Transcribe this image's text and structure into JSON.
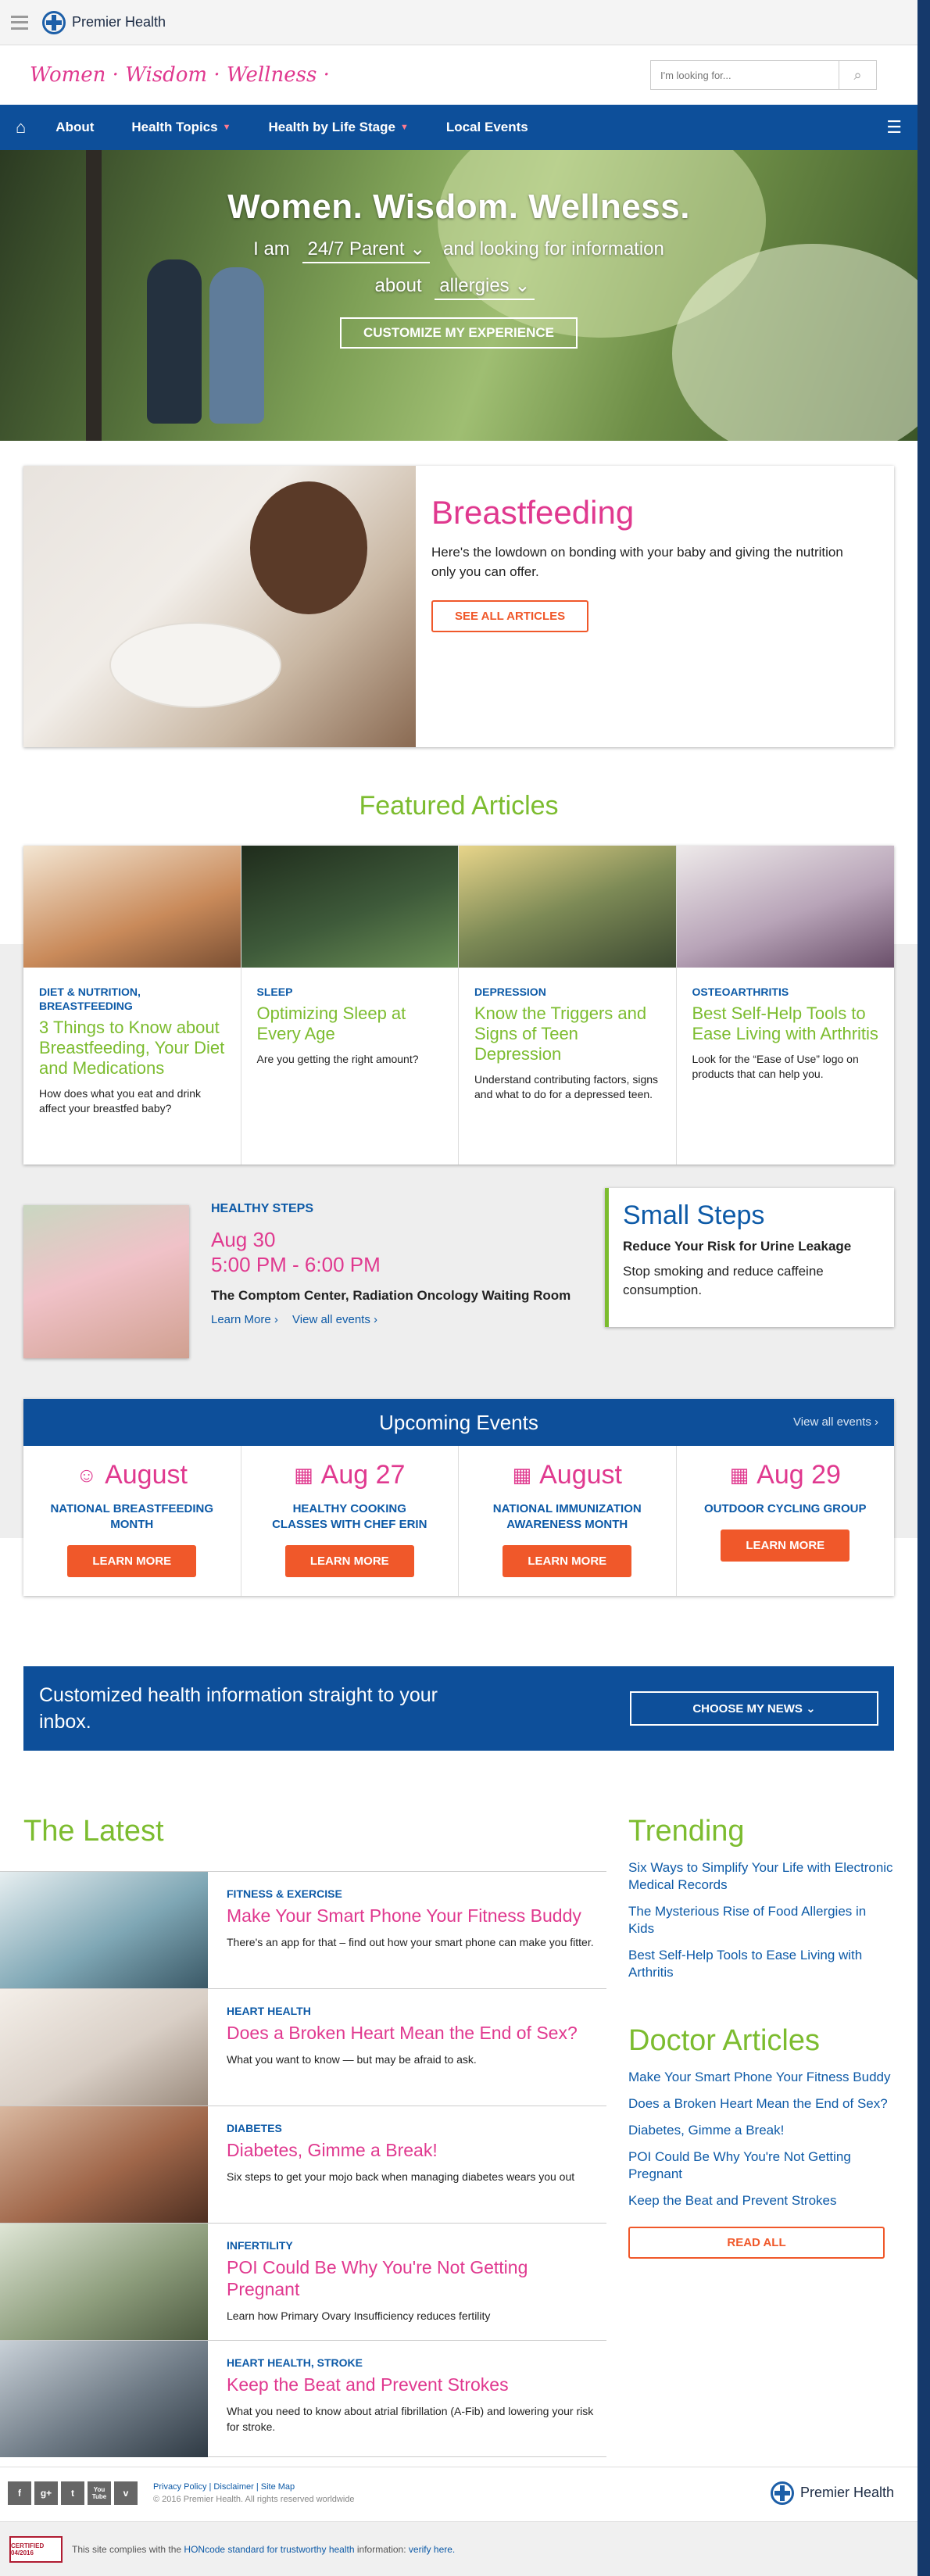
{
  "header": {
    "brand": "Premier Health",
    "tagline": "Women · Wisdom · Wellness ·",
    "search_placeholder": "I'm looking for..."
  },
  "nav": {
    "items": [
      {
        "label": "About"
      },
      {
        "label": "Health Topics"
      },
      {
        "label": "Health by Life Stage"
      },
      {
        "label": "Local Events"
      }
    ]
  },
  "hero": {
    "title": "Women. Wisdom. Wellness.",
    "iam": "I am",
    "persona": "24/7 Parent",
    "looking": "and looking for information",
    "about": "about",
    "topic": "allergies",
    "button": "CUSTOMIZE MY EXPERIENCE"
  },
  "feature": {
    "title": "Breastfeeding",
    "text": "Here's the lowdown on bonding with your baby and giving the nutrition only you can offer.",
    "button": "SEE ALL ARTICLES"
  },
  "featured": {
    "heading": "Featured Articles",
    "cards": [
      {
        "category": "Diet & Nutrition, Breastfeeding",
        "title": "3 Things to Know about Breastfeeding, Your Diet and Medications",
        "desc": "How does what you eat and drink affect your breastfed baby?",
        "color": "#c98a5a"
      },
      {
        "category": "Sleep",
        "title": "Optimizing Sleep at Every Age",
        "desc": "Are you getting the right amount?",
        "color": "#3e5a3a"
      },
      {
        "category": "Depression",
        "title": "Know the Triggers and Signs of Teen Depression",
        "desc": "Understand contributing factors, signs and what to do for a depressed teen.",
        "color": "#7d8a56"
      },
      {
        "category": "Osteoarthritis",
        "title": "Best Self-Help Tools to Ease Living with Arthritis",
        "desc": "Look for the “Ease of Use” logo on products that can help you.",
        "color": "#b8a4b8"
      }
    ]
  },
  "healthy_steps": {
    "label": "HEALTHY STEPS",
    "date": "Aug 30",
    "time": "5:00 PM - 6:00 PM",
    "location": "The Comptom Center, Radiation Oncology Waiting Room",
    "learn_more": "Learn More ›",
    "view_all": "View all events ›"
  },
  "small_steps": {
    "title": "Small Steps",
    "subtitle": "Reduce Your Risk for Urine Leakage",
    "text": "Stop smoking and reduce caffeine consumption."
  },
  "events": {
    "heading": "Upcoming Events",
    "view_all": "View all events ›",
    "items": [
      {
        "date": "August",
        "icon": "baby-icon",
        "glyph": "☺",
        "name": "NATIONAL BREASTFEEDING MONTH",
        "button": "LEARN MORE"
      },
      {
        "date": "Aug 27",
        "icon": "calendar-icon",
        "glyph": "▦",
        "name": "HEALTHY COOKING CLASSES WITH CHEF ERIN",
        "button": "LEARN MORE"
      },
      {
        "date": "August",
        "icon": "calendar-icon",
        "glyph": "▦",
        "name": "NATIONAL IMMUNIZATION AWARENESS MONTH",
        "button": "LEARN MORE"
      },
      {
        "date": "Aug 29",
        "icon": "calendar-icon",
        "glyph": "▦",
        "name": "OUTDOOR CYCLING GROUP",
        "button": "LEARN MORE"
      }
    ]
  },
  "newsletter": {
    "text": "Customized health information straight to your inbox.",
    "button": "CHOOSE MY NEWS ⌄"
  },
  "latest": {
    "heading": "The Latest",
    "items": [
      {
        "category": "Fitness & Exercise",
        "title": "Make Your Smart Phone Your Fitness Buddy",
        "desc": "There's an app for that – find out how your smart phone can make you fitter.",
        "color": "#7fa7b5"
      },
      {
        "category": "Heart Health",
        "title": "Does a Broken Heart Mean the End of Sex?",
        "desc": "What you want to know — but may be afraid to ask.",
        "color": "#d9cfc6"
      },
      {
        "category": "Diabetes",
        "title": "Diabetes, Gimme a Break!",
        "desc": "Six steps to get your mojo back when managing diabetes wears you out",
        "color": "#a0674a"
      },
      {
        "category": "Infertility",
        "title": "POI Could Be Why You're Not Getting Pregnant",
        "desc": "Learn how Primary Ovary Insufficiency reduces fertility",
        "color": "#8e9e7d"
      },
      {
        "category": "Heart Health, Stroke",
        "title": "Keep the Beat and Prevent Strokes",
        "desc": "What you need to know about atrial fibrillation (A-Fib) and lowering your risk for stroke.",
        "color": "#6f7b86"
      }
    ]
  },
  "trending": {
    "heading": "Trending",
    "items": [
      "Six Ways to Simplify Your Life with Electronic Medical Records",
      "The Mysterious Rise of Food Allergies in Kids",
      "Best Self-Help Tools to Ease Living with Arthritis"
    ]
  },
  "doctor_articles": {
    "heading": "Doctor Articles",
    "items": [
      "Make Your Smart Phone Your Fitness Buddy",
      "Does a Broken Heart Mean the End of Sex?",
      "Diabetes, Gimme a Break!",
      "POI Could Be Why You're Not Getting Pregnant",
      "Keep the Beat and Prevent Strokes"
    ],
    "button": "READ ALL"
  },
  "footer": {
    "social": [
      "f",
      "g+",
      "t",
      "You Tube",
      "v"
    ],
    "links": "Privacy Policy | Disclaimer | Site Map",
    "copyright": "© 2016 Premier Health. All rights reserved worldwide",
    "brand": "Premier Health",
    "hon_badge": "CERTIFIED 04/2016",
    "hon_prefix": "This site complies with the",
    "hon_link": "HONcode standard for trustworthy health",
    "hon_middle": "information:",
    "hon_verify": "verify here."
  },
  "colors": {
    "brand_blue": "#0d4f9a",
    "pink": "#e0398f",
    "green": "#7cbc2f",
    "orange": "#f0582a"
  }
}
